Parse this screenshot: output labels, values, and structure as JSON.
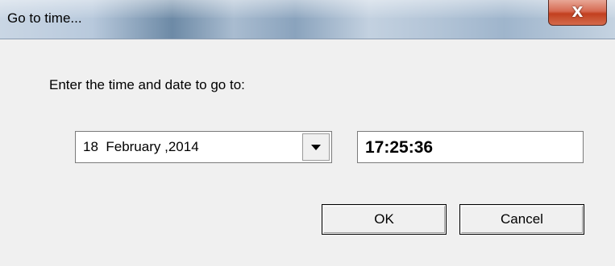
{
  "window": {
    "title": "Go to time...",
    "close_glyph": "X"
  },
  "dialog": {
    "prompt": "Enter the time and date to go to:",
    "date_value": "18  February ,2014",
    "time_value": "17:25:36",
    "ok_label": "OK",
    "cancel_label": "Cancel"
  },
  "icons": {
    "close": "close-icon",
    "dropdown": "chevron-down-icon"
  },
  "colors": {
    "dialog_background": "#f0f0f0",
    "close_button": "#c2401f"
  }
}
